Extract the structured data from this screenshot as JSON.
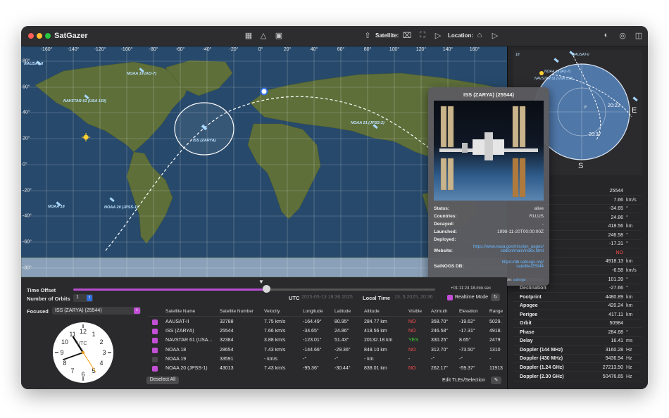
{
  "app": {
    "title": "SatGazer"
  },
  "toolbar": {
    "satellite_label": "Satellite:",
    "location_label": "Location:"
  },
  "map": {
    "lon_ticks": [
      "-160°",
      "-140°",
      "-120°",
      "-100°",
      "-80°",
      "-60°",
      "-40°",
      "-20°",
      "0°",
      "20°",
      "40°",
      "60°",
      "80°",
      "100°",
      "120°",
      "140°",
      "160°"
    ],
    "lat_ticks": [
      "80°",
      "60°",
      "40°",
      "20°",
      "0°",
      "-20°",
      "-40°",
      "-60°",
      "-80°"
    ],
    "labels": {
      "aausat": "AAUSAT-II",
      "noaa19": "NOAA 19 (AO-7)",
      "navstar": "NAVSTAR 61 (USA 150)",
      "iss": "ISS (ZARYA)",
      "noaa21": "NOAA 21 (JPSS-2)",
      "noaa18": "NOAA 18",
      "noaa20": "NOAA 20 (JPSS-1)"
    },
    "colors": {
      "ocean": "#27496b",
      "land": "#5c6e3a",
      "track": "#ffffff"
    }
  },
  "popup": {
    "title": "ISS (ZARYA) (25544)",
    "rows": [
      {
        "k": "Status:",
        "v": "alive"
      },
      {
        "k": "Countries:",
        "v": "RU,US"
      },
      {
        "k": "Decayed:",
        "v": "-"
      },
      {
        "k": "Launched:",
        "v": "1998-11-20T00:00:00Z"
      },
      {
        "k": "Deployed:",
        "v": ""
      }
    ],
    "website_label": "Website:",
    "website_line1": "https://www.nasa.gov/mission_pages/",
    "website_line2": "station/main/index.html",
    "satnogs_label": "SatNOGS DB:",
    "satnogs_line1": "https://db.satnogs.org/",
    "satnogs_line2": "satellite/25544",
    "data_from": "Data from:",
    "data_from_link": "satnogs"
  },
  "polar": {
    "east": "E",
    "south": "S",
    "time1": "20:22",
    "time2": "20:37",
    "lbl_aausat": "AAUSAT-II",
    "lbl_noaa": "NOAA 19 (AO-7)",
    "lbl_navstar": "NAVSTAR 61 (USA 150)",
    "lbl_18": "18",
    "north_tick": "0°"
  },
  "details": [
    {
      "k": "Number",
      "v": "25544",
      "u": ""
    },
    {
      "k": "",
      "v": "7.66",
      "u": "km/s"
    },
    {
      "k": "",
      "v": "-34.65",
      "u": "°"
    },
    {
      "k": "",
      "v": "24.86",
      "u": "°"
    },
    {
      "k": "",
      "v": "418.56",
      "u": "km"
    },
    {
      "k": "",
      "v": "246.58",
      "u": "°"
    },
    {
      "k": "",
      "v": "-17.31",
      "u": "°"
    },
    {
      "k": "",
      "v": "NO",
      "u": ""
    },
    {
      "k": "",
      "v": "4918.13",
      "u": "km"
    },
    {
      "k": "",
      "v": "-6.58",
      "u": "km/s"
    },
    {
      "k": "Ascension",
      "v": "101.39",
      "u": "°"
    },
    {
      "k": "Declination",
      "v": "-27.66",
      "u": "°"
    },
    {
      "k": "Footprint",
      "v": "4480.89",
      "u": "km"
    },
    {
      "k": "Apogee",
      "v": "420.24",
      "u": "km"
    },
    {
      "k": "Perigee",
      "v": "417.11",
      "u": "km"
    },
    {
      "k": "Orbit",
      "v": "50984",
      "u": ""
    },
    {
      "k": "Phase",
      "v": "284.68",
      "u": "°"
    },
    {
      "k": "Delay",
      "v": "16.41",
      "u": "ms"
    },
    {
      "k": "Doppler (144 MHz)",
      "v": "3160.28",
      "u": "Hz"
    },
    {
      "k": "Doppler (430 MHz)",
      "v": "9436.94",
      "u": "Hz"
    },
    {
      "k": "Doppler (1.24 GHz)",
      "v": "27213.50",
      "u": "Hz"
    },
    {
      "k": "Doppler (2.30 GHz)",
      "v": "50476.65",
      "u": "Hz"
    }
  ],
  "bottom": {
    "time_offset": "Time Offset",
    "num_orbits": "Number of Orbits",
    "num_orbits_value": "1",
    "utc_label": "UTC",
    "utc_value": "2025-05-13 18:36 2025",
    "local_label": "Local Time",
    "local_value": "13.  5.2025, 20:36",
    "slider_readout": "+01:11:24  18.min.sec",
    "realtime_label": "Realtime Mode",
    "focused_label": "Focused",
    "focused_value": "ISS (ZARYA) (25544)",
    "clock_utc": "UTC",
    "deselect": "Deselect All",
    "edit_tles": "Edit TLEs/Selection"
  },
  "table": {
    "headers": [
      "Satellite Name",
      "Satellite Number",
      "Velocity",
      "Longitude",
      "Latitude",
      "Altitude",
      "Visible",
      "Azimuth",
      "Elevation",
      "Range"
    ],
    "rows": [
      {
        "checked": true,
        "name": "AAUSAT-II",
        "num": "32788",
        "vel": "7.75 km/s",
        "lon": "-164.49°",
        "lat": "80.95°",
        "alt": "284.77 km",
        "vis": "NO",
        "az": "358.70°",
        "el": "-19.62°",
        "rng": "5029."
      },
      {
        "checked": true,
        "name": "ISS (ZARYA)",
        "num": "25544",
        "vel": "7.66 km/s",
        "lon": "-34.65°",
        "lat": "24.86°",
        "alt": "418.56 km",
        "vis": "NO",
        "az": "246.58°",
        "el": "-17.31°",
        "rng": "4918."
      },
      {
        "checked": true,
        "name": "NAVSTAR 61 (USA...",
        "num": "32384",
        "vel": "3.88 km/s",
        "lon": "-123.01°",
        "lat": "51.43°",
        "alt": "20132.18 km",
        "vis": "YES",
        "az": "330.25°",
        "el": "8.65°",
        "rng": "2479"
      },
      {
        "checked": true,
        "name": "NOAA 18",
        "num": "28654",
        "vel": "7.43 km/s",
        "lon": "-144.66°",
        "lat": "-29.36°",
        "alt": "848.10 km",
        "vis": "NO",
        "az": "312.70°",
        "el": "-73.50°",
        "rng": "1310"
      },
      {
        "checked": false,
        "name": "NOAA 19",
        "num": "33591",
        "vel": "- km/s",
        "lon": "-°",
        "lat": "-°",
        "alt": "- km",
        "vis": "-",
        "az": "-°",
        "el": "-°",
        "rng": "-"
      },
      {
        "checked": true,
        "name": "NOAA 20 (JPSS-1)",
        "num": "43013",
        "vel": "7.43 km/s",
        "lon": "-95.36°",
        "lat": "-30.44°",
        "alt": "838.01 km",
        "vis": "NO",
        "az": "262.17°",
        "el": "-59.37°",
        "rng": "11913"
      }
    ]
  }
}
